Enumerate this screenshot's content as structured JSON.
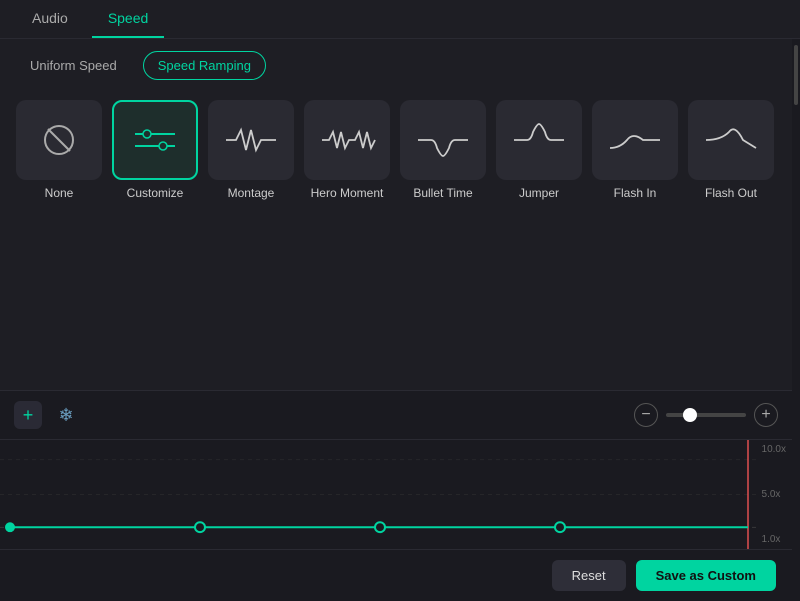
{
  "tabs": {
    "audio": "Audio",
    "speed": "Speed",
    "active": "speed"
  },
  "speed_modes": {
    "uniform": "Uniform Speed",
    "ramping": "Speed Ramping",
    "active": "ramping"
  },
  "presets": [
    {
      "id": "none",
      "label": "None",
      "svg_type": "circle-slash"
    },
    {
      "id": "customize",
      "label": "Customize",
      "svg_type": "sliders",
      "selected": true
    },
    {
      "id": "montage",
      "label": "Montage",
      "svg_type": "wave-small"
    },
    {
      "id": "hero_moment",
      "label": "Hero\nMoment",
      "svg_type": "wave-double"
    },
    {
      "id": "bullet_time",
      "label": "Bullet\nTime",
      "svg_type": "wave-dip"
    },
    {
      "id": "jumper",
      "label": "Jumper",
      "svg_type": "wave-peak"
    },
    {
      "id": "flash_in",
      "label": "Flash In",
      "svg_type": "wave-rise"
    },
    {
      "id": "flash_out",
      "label": "Flash Out",
      "svg_type": "wave-fall"
    }
  ],
  "timeline": {
    "add_btn": "+",
    "freeze_btn": "❄",
    "zoom_labels": [
      "10.0x",
      "5.0x",
      "1.0x"
    ]
  },
  "buttons": {
    "reset": "Reset",
    "save_as_custom": "Save as Custom"
  }
}
